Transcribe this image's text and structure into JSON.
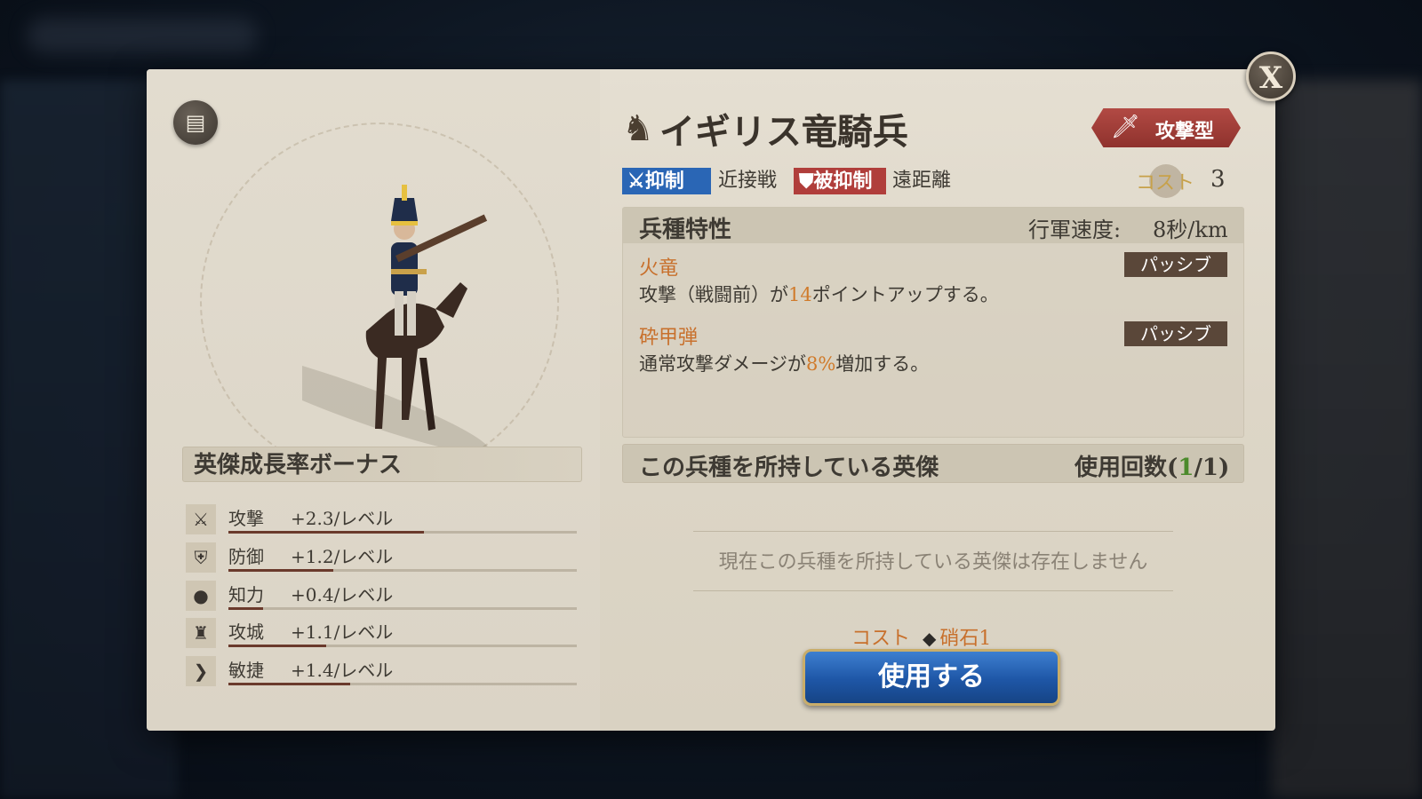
{
  "unit": {
    "name": "イギリス竜騎兵",
    "type_badge": "攻撃型",
    "suppress_tag": "抑制",
    "suppress_target": "近接戦",
    "suppressed_tag": "被抑制",
    "suppressed_by": "遠距離",
    "cost_label": "コスト",
    "cost_value": "3"
  },
  "traits": {
    "title": "兵種特性",
    "march_label": "行軍速度:",
    "march_value": "8秒/km",
    "items": [
      {
        "name": "火竜",
        "tag": "パッシブ",
        "desc_pre": "攻撃（戦闘前）が",
        "desc_hl": "14",
        "desc_post": "ポイントアップする。"
      },
      {
        "name": "砕甲弾",
        "tag": "パッシブ",
        "desc_pre": "通常攻撃ダメージが",
        "desc_hl": "8%",
        "desc_post": "増加する。"
      }
    ]
  },
  "owners": {
    "title": "この兵種を所持している英傑",
    "uses_label": "使用回数(",
    "uses_current": "1",
    "uses_total": "/1)",
    "empty_text": "現在この兵種を所持している英傑は存在しません"
  },
  "use": {
    "cost_label": "コスト",
    "cost_item": "硝石1",
    "button_label": "使用する"
  },
  "growth": {
    "title": "英傑成長率ボーナス",
    "stats": [
      {
        "icon": "sword-icon",
        "name": "攻撃",
        "value": "+2.3/レベル",
        "fill": 0.56
      },
      {
        "icon": "shield-icon",
        "name": "防御",
        "value": "+1.2/レベル",
        "fill": 0.3
      },
      {
        "icon": "head-icon",
        "name": "知力",
        "value": "+0.4/レベル",
        "fill": 0.1
      },
      {
        "icon": "castle-icon",
        "name": "攻城",
        "value": "+1.1/レベル",
        "fill": 0.28
      },
      {
        "icon": "boot-icon",
        "name": "敏捷",
        "value": "+1.4/レベル",
        "fill": 0.35
      }
    ]
  },
  "close_label": "X",
  "colors": {
    "accent_orange": "#c8702c",
    "badge_red": "#b03e3b",
    "tag_blue": "#2a66b5",
    "button_blue": "#1e56a6"
  }
}
